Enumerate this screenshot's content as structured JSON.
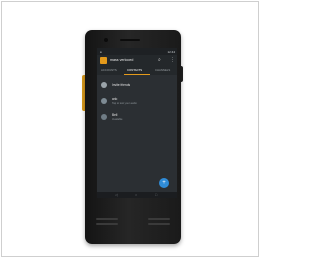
{
  "app": {
    "title": "mass verlooed",
    "search_icon": "search-icon",
    "more_icon": "more-vert-icon"
  },
  "status": {
    "time": "12:44"
  },
  "tabs": [
    {
      "label": "ACCOUNTS"
    },
    {
      "label": "CONTACTS"
    },
    {
      "label": "CHANNELS"
    }
  ],
  "contacts": [
    {
      "name": "Invite friends",
      "subtitle": ""
    },
    {
      "name": "arlo",
      "subtitle": "Tap to test your audio"
    },
    {
      "name": "Bell",
      "subtitle": "Available"
    }
  ],
  "fab": {
    "label": "+"
  },
  "colors": {
    "accent": "#e49a1b",
    "fab": "#2f8cd8",
    "screen_bg": "#2b2f33"
  }
}
